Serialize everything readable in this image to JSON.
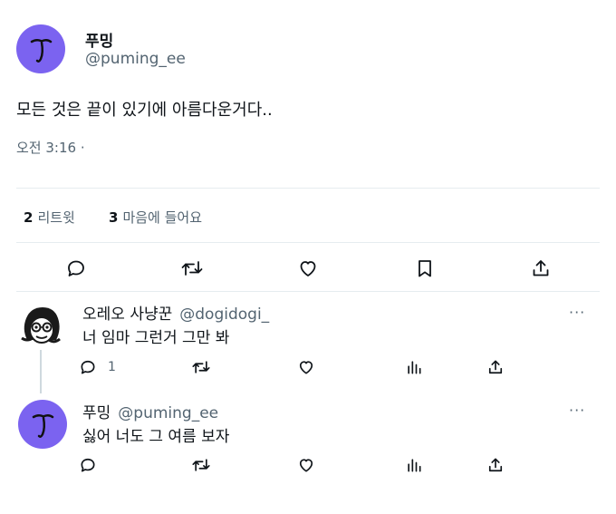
{
  "main_tweet": {
    "author_name": "푸밍",
    "author_handle": "@puming_ee",
    "text": "모든 것은 끝이 있기에 아름다운거다..",
    "time": "오전 3:16 ·",
    "stats": {
      "retweet_count": "2",
      "retweet_label": "리트윗",
      "like_count": "3",
      "like_label": "마음에 들어요"
    },
    "actions": [
      "reply-icon",
      "retweet-icon",
      "like-icon",
      "bookmark-icon",
      "share-icon"
    ]
  },
  "replies": [
    {
      "name": "오레오 사냥꾼",
      "handle": "@dogidogi_",
      "text": "너 임마 그런거 그만 봐",
      "reply_count": "1",
      "more": "···"
    },
    {
      "name": "푸밍",
      "handle": "@puming_ee",
      "text": "싫어 너도 그 여름 보자",
      "reply_count": "",
      "more": "···"
    }
  ],
  "colors": {
    "avatar": "#7b63f0",
    "text_primary": "#0f1419",
    "text_secondary": "#536471",
    "divider": "#e6ecf0"
  }
}
